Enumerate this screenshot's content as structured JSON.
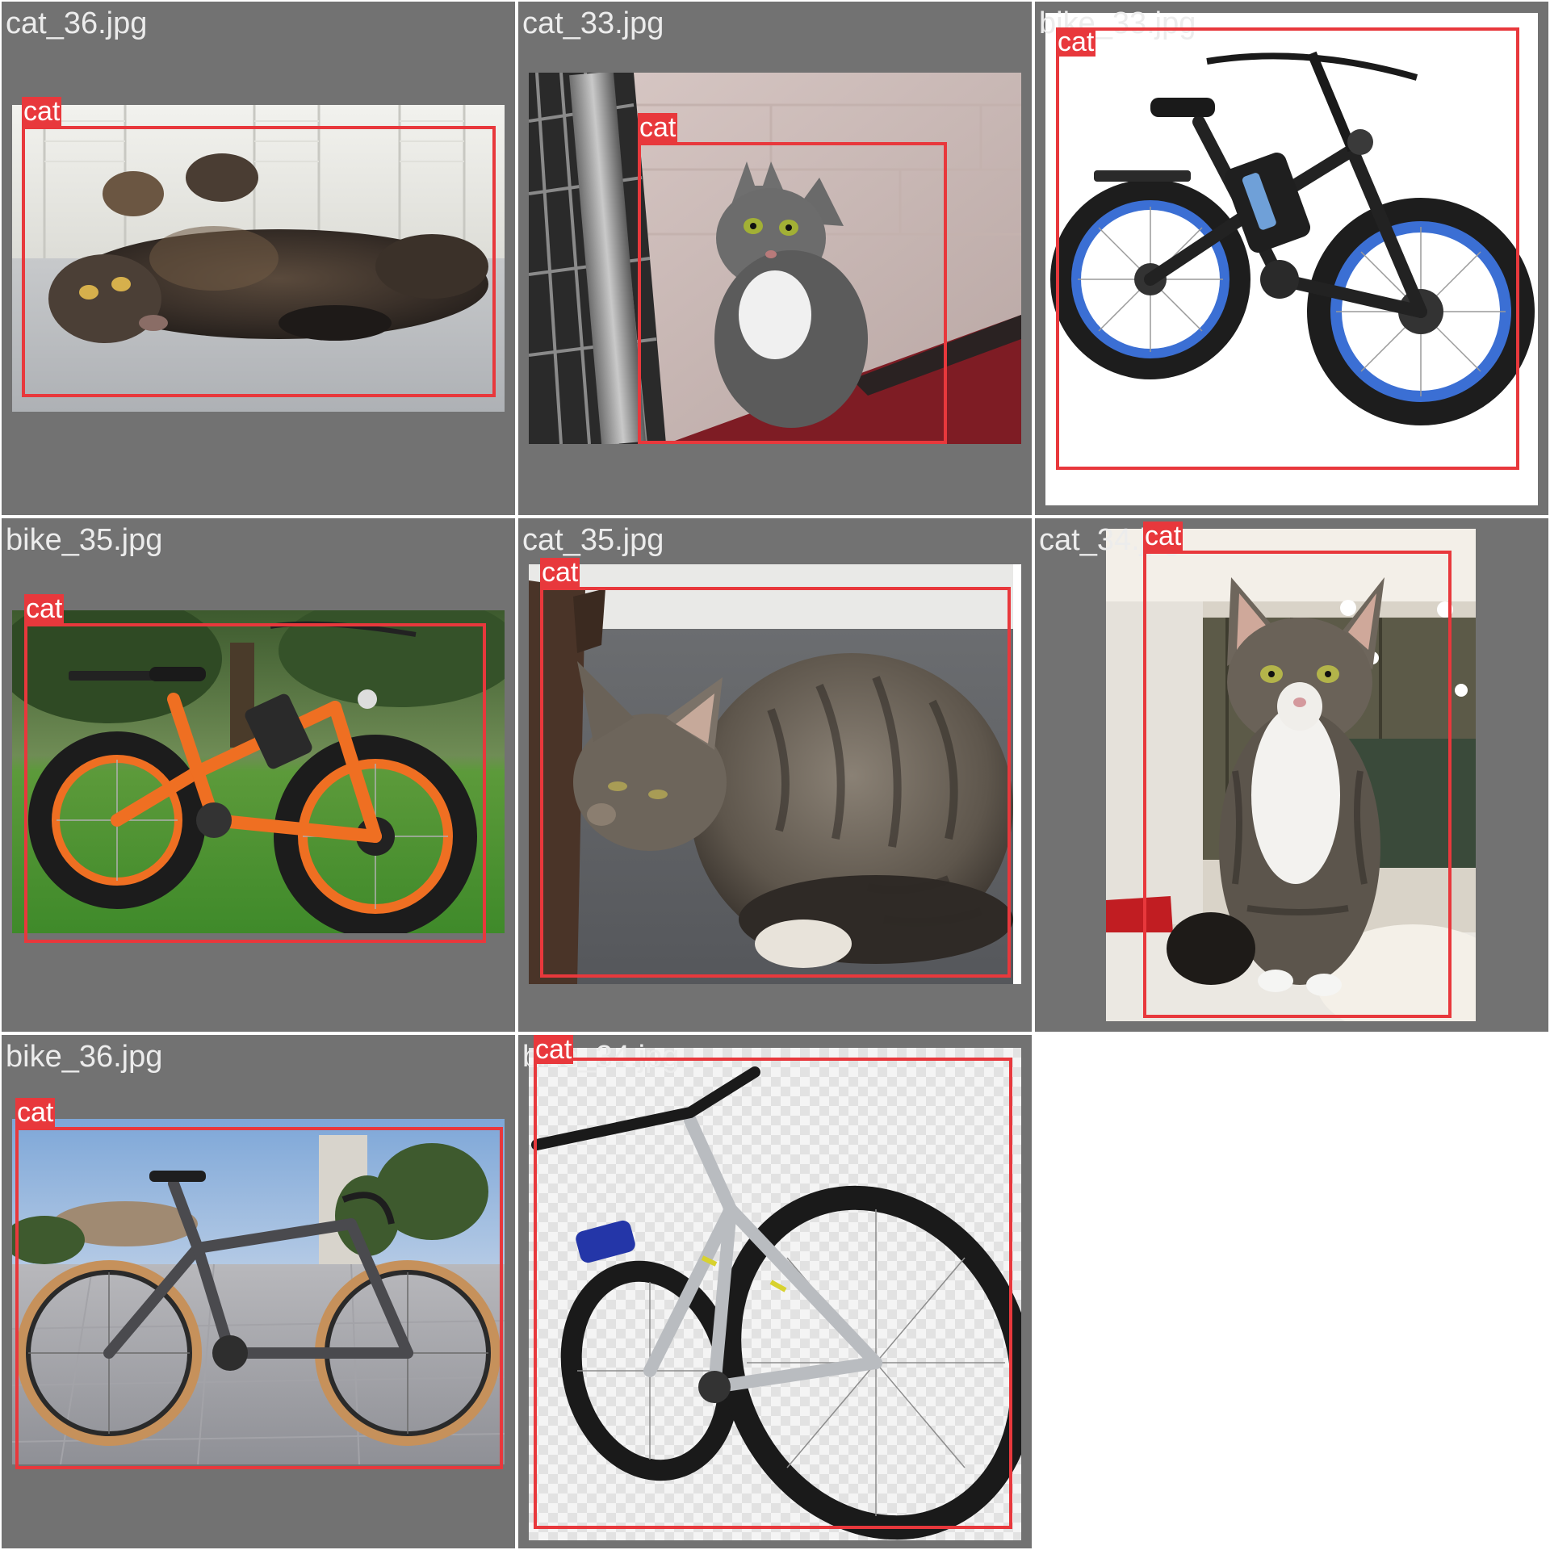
{
  "colors": {
    "cell_background": "#727272",
    "page_background": "#ffffff",
    "box_color": "#e8383c",
    "label_text": "#ffffff",
    "filename_text": "#ececec"
  },
  "tiles": [
    {
      "filename": "cat_36.jpg",
      "subject": "cat lying on its back on a grey carpet in front of white shutters",
      "detections": [
        {
          "label": "cat"
        }
      ]
    },
    {
      "filename": "cat_33.jpg",
      "subject": "grey and white cat sitting next to a cage",
      "detections": [
        {
          "label": "cat"
        }
      ]
    },
    {
      "filename": "bike_33.jpg",
      "subject": "black electric fat-tire bike with blue rims",
      "detections": [
        {
          "label": "cat"
        }
      ]
    },
    {
      "filename": "bike_35.jpg",
      "subject": "orange electric fat-tire bike on grass",
      "detections": [
        {
          "label": "cat"
        }
      ]
    },
    {
      "filename": "cat_35.jpg",
      "subject": "brown tabby cat crouching on a carpet",
      "detections": [
        {
          "label": "cat"
        }
      ]
    },
    {
      "filename": "cat_34.jpg",
      "subject": "tabby and white cat sitting on a blanket",
      "detections": [
        {
          "label": "cat"
        }
      ]
    },
    {
      "filename": "bike_36.jpg",
      "subject": "grey gravel bike with tan-wall tires on a plaza",
      "detections": [
        {
          "label": "cat"
        }
      ]
    },
    {
      "filename": "bike_34.jpg",
      "subject": "silver mountain bike on a transparent checkered background",
      "detections": [
        {
          "label": "cat"
        }
      ]
    }
  ]
}
